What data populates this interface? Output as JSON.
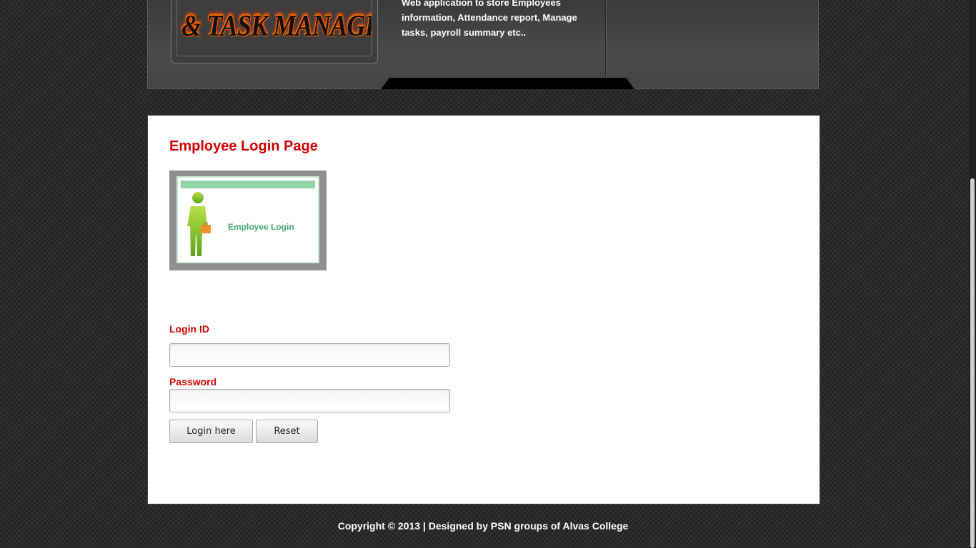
{
  "header": {
    "logo_text": "& TASK MANAGER",
    "description": "Web application to store Employees information, Attendance report, Manage tasks, payroll summary etc.."
  },
  "main": {
    "title": "Employee Login Page",
    "image_caption": "Employee Login",
    "login_label": "Login ID",
    "login_value": "",
    "password_label": "Password",
    "password_value": "",
    "login_button": "Login here",
    "reset_button": "Reset"
  },
  "footer": {
    "copyright": "Copyright © 2013 | Designed by PSN groups of Alvas College"
  },
  "colors": {
    "accent": "#d40000",
    "background": "#2b2b2b"
  }
}
